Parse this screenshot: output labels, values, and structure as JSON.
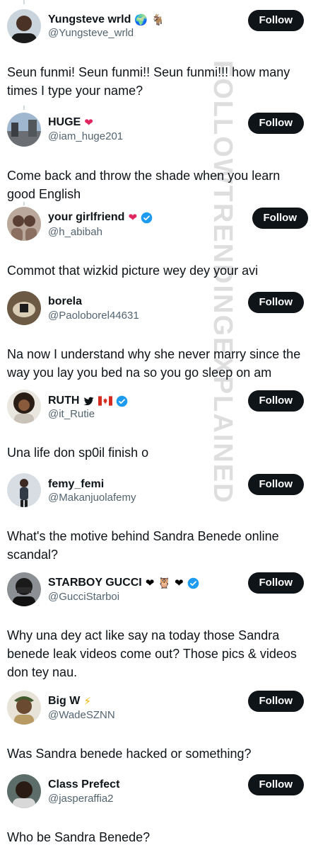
{
  "watermark": "FOLLOWTRENDINGEXPLAINED",
  "follow_label": "Follow",
  "colors": {
    "button_bg": "#0f1419",
    "button_text": "#ffffff",
    "handle": "#536471",
    "verified": "#1d9bf0",
    "heart_red": "#e0245e"
  },
  "posts": [
    {
      "name": "Yungsteve wrld",
      "badges": [
        "globe-icon",
        "goat-icon"
      ],
      "handle": "@Yungsteve_wrld",
      "text": "Seun funmi! Seun funmi!! Seun funmi!!! how many times I type your name?"
    },
    {
      "name": "HUGE",
      "badges": [
        "heart-icon"
      ],
      "handle": "@iam_huge201",
      "text": "Come back and throw the shade when you learn good English"
    },
    {
      "name": "your girlfriend",
      "badges": [
        "red-heart-icon",
        "verified-icon"
      ],
      "handle": "@h_abibah",
      "text": "Commot that wizkid picture wey dey your avi"
    },
    {
      "name": "borela",
      "badges": [],
      "handle": "@Paoloborel44631",
      "text": "Na now I understand why she never marry since the way you lay you bed na so you go sleep on am"
    },
    {
      "name": "RUTH",
      "badges": [
        "bird-icon",
        "canada-flag-icon",
        "verified-icon"
      ],
      "handle": "@it_Rutie",
      "text": "Una life don sp0il finish o"
    },
    {
      "name": "femy_femi",
      "badges": [],
      "handle": "@Makanjuolafemy",
      "text": "What's the motive behind Sandra Benede online scandal?"
    },
    {
      "name": "STARBOY GUCCI",
      "badges": [
        "black-heart-icon",
        "owl-icon",
        "black-heart-icon",
        "verified-icon"
      ],
      "handle": "@GucciStarboi",
      "text": "Why una dey act like say na today those Sandra benede leak videos come out? Those pics & videos don tey nau."
    },
    {
      "name": "Big W",
      "badges": [
        "lightning-icon"
      ],
      "handle": "@WadeSZNN",
      "text": "Was Sandra benede hacked or something?"
    },
    {
      "name": "Class Prefect",
      "badges": [],
      "handle": "@jasperaffia2",
      "text": "Who be Sandra Benede?"
    }
  ]
}
